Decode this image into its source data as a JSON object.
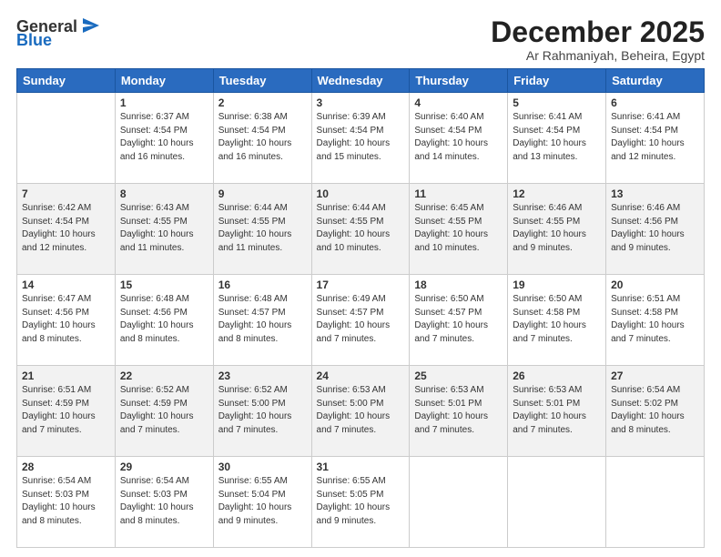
{
  "logo": {
    "general": "General",
    "blue": "Blue"
  },
  "title": "December 2025",
  "location": "Ar Rahmaniyah, Beheira, Egypt",
  "days_of_week": [
    "Sunday",
    "Monday",
    "Tuesday",
    "Wednesday",
    "Thursday",
    "Friday",
    "Saturday"
  ],
  "weeks": [
    [
      {
        "day": "",
        "info": ""
      },
      {
        "day": "1",
        "info": "Sunrise: 6:37 AM\nSunset: 4:54 PM\nDaylight: 10 hours\nand 16 minutes."
      },
      {
        "day": "2",
        "info": "Sunrise: 6:38 AM\nSunset: 4:54 PM\nDaylight: 10 hours\nand 16 minutes."
      },
      {
        "day": "3",
        "info": "Sunrise: 6:39 AM\nSunset: 4:54 PM\nDaylight: 10 hours\nand 15 minutes."
      },
      {
        "day": "4",
        "info": "Sunrise: 6:40 AM\nSunset: 4:54 PM\nDaylight: 10 hours\nand 14 minutes."
      },
      {
        "day": "5",
        "info": "Sunrise: 6:41 AM\nSunset: 4:54 PM\nDaylight: 10 hours\nand 13 minutes."
      },
      {
        "day": "6",
        "info": "Sunrise: 6:41 AM\nSunset: 4:54 PM\nDaylight: 10 hours\nand 12 minutes."
      }
    ],
    [
      {
        "day": "7",
        "info": "Sunrise: 6:42 AM\nSunset: 4:54 PM\nDaylight: 10 hours\nand 12 minutes."
      },
      {
        "day": "8",
        "info": "Sunrise: 6:43 AM\nSunset: 4:55 PM\nDaylight: 10 hours\nand 11 minutes."
      },
      {
        "day": "9",
        "info": "Sunrise: 6:44 AM\nSunset: 4:55 PM\nDaylight: 10 hours\nand 11 minutes."
      },
      {
        "day": "10",
        "info": "Sunrise: 6:44 AM\nSunset: 4:55 PM\nDaylight: 10 hours\nand 10 minutes."
      },
      {
        "day": "11",
        "info": "Sunrise: 6:45 AM\nSunset: 4:55 PM\nDaylight: 10 hours\nand 10 minutes."
      },
      {
        "day": "12",
        "info": "Sunrise: 6:46 AM\nSunset: 4:55 PM\nDaylight: 10 hours\nand 9 minutes."
      },
      {
        "day": "13",
        "info": "Sunrise: 6:46 AM\nSunset: 4:56 PM\nDaylight: 10 hours\nand 9 minutes."
      }
    ],
    [
      {
        "day": "14",
        "info": "Sunrise: 6:47 AM\nSunset: 4:56 PM\nDaylight: 10 hours\nand 8 minutes."
      },
      {
        "day": "15",
        "info": "Sunrise: 6:48 AM\nSunset: 4:56 PM\nDaylight: 10 hours\nand 8 minutes."
      },
      {
        "day": "16",
        "info": "Sunrise: 6:48 AM\nSunset: 4:57 PM\nDaylight: 10 hours\nand 8 minutes."
      },
      {
        "day": "17",
        "info": "Sunrise: 6:49 AM\nSunset: 4:57 PM\nDaylight: 10 hours\nand 7 minutes."
      },
      {
        "day": "18",
        "info": "Sunrise: 6:50 AM\nSunset: 4:57 PM\nDaylight: 10 hours\nand 7 minutes."
      },
      {
        "day": "19",
        "info": "Sunrise: 6:50 AM\nSunset: 4:58 PM\nDaylight: 10 hours\nand 7 minutes."
      },
      {
        "day": "20",
        "info": "Sunrise: 6:51 AM\nSunset: 4:58 PM\nDaylight: 10 hours\nand 7 minutes."
      }
    ],
    [
      {
        "day": "21",
        "info": "Sunrise: 6:51 AM\nSunset: 4:59 PM\nDaylight: 10 hours\nand 7 minutes."
      },
      {
        "day": "22",
        "info": "Sunrise: 6:52 AM\nSunset: 4:59 PM\nDaylight: 10 hours\nand 7 minutes."
      },
      {
        "day": "23",
        "info": "Sunrise: 6:52 AM\nSunset: 5:00 PM\nDaylight: 10 hours\nand 7 minutes."
      },
      {
        "day": "24",
        "info": "Sunrise: 6:53 AM\nSunset: 5:00 PM\nDaylight: 10 hours\nand 7 minutes."
      },
      {
        "day": "25",
        "info": "Sunrise: 6:53 AM\nSunset: 5:01 PM\nDaylight: 10 hours\nand 7 minutes."
      },
      {
        "day": "26",
        "info": "Sunrise: 6:53 AM\nSunset: 5:01 PM\nDaylight: 10 hours\nand 7 minutes."
      },
      {
        "day": "27",
        "info": "Sunrise: 6:54 AM\nSunset: 5:02 PM\nDaylight: 10 hours\nand 8 minutes."
      }
    ],
    [
      {
        "day": "28",
        "info": "Sunrise: 6:54 AM\nSunset: 5:03 PM\nDaylight: 10 hours\nand 8 minutes."
      },
      {
        "day": "29",
        "info": "Sunrise: 6:54 AM\nSunset: 5:03 PM\nDaylight: 10 hours\nand 8 minutes."
      },
      {
        "day": "30",
        "info": "Sunrise: 6:55 AM\nSunset: 5:04 PM\nDaylight: 10 hours\nand 9 minutes."
      },
      {
        "day": "31",
        "info": "Sunrise: 6:55 AM\nSunset: 5:05 PM\nDaylight: 10 hours\nand 9 minutes."
      },
      {
        "day": "",
        "info": ""
      },
      {
        "day": "",
        "info": ""
      },
      {
        "day": "",
        "info": ""
      }
    ]
  ]
}
